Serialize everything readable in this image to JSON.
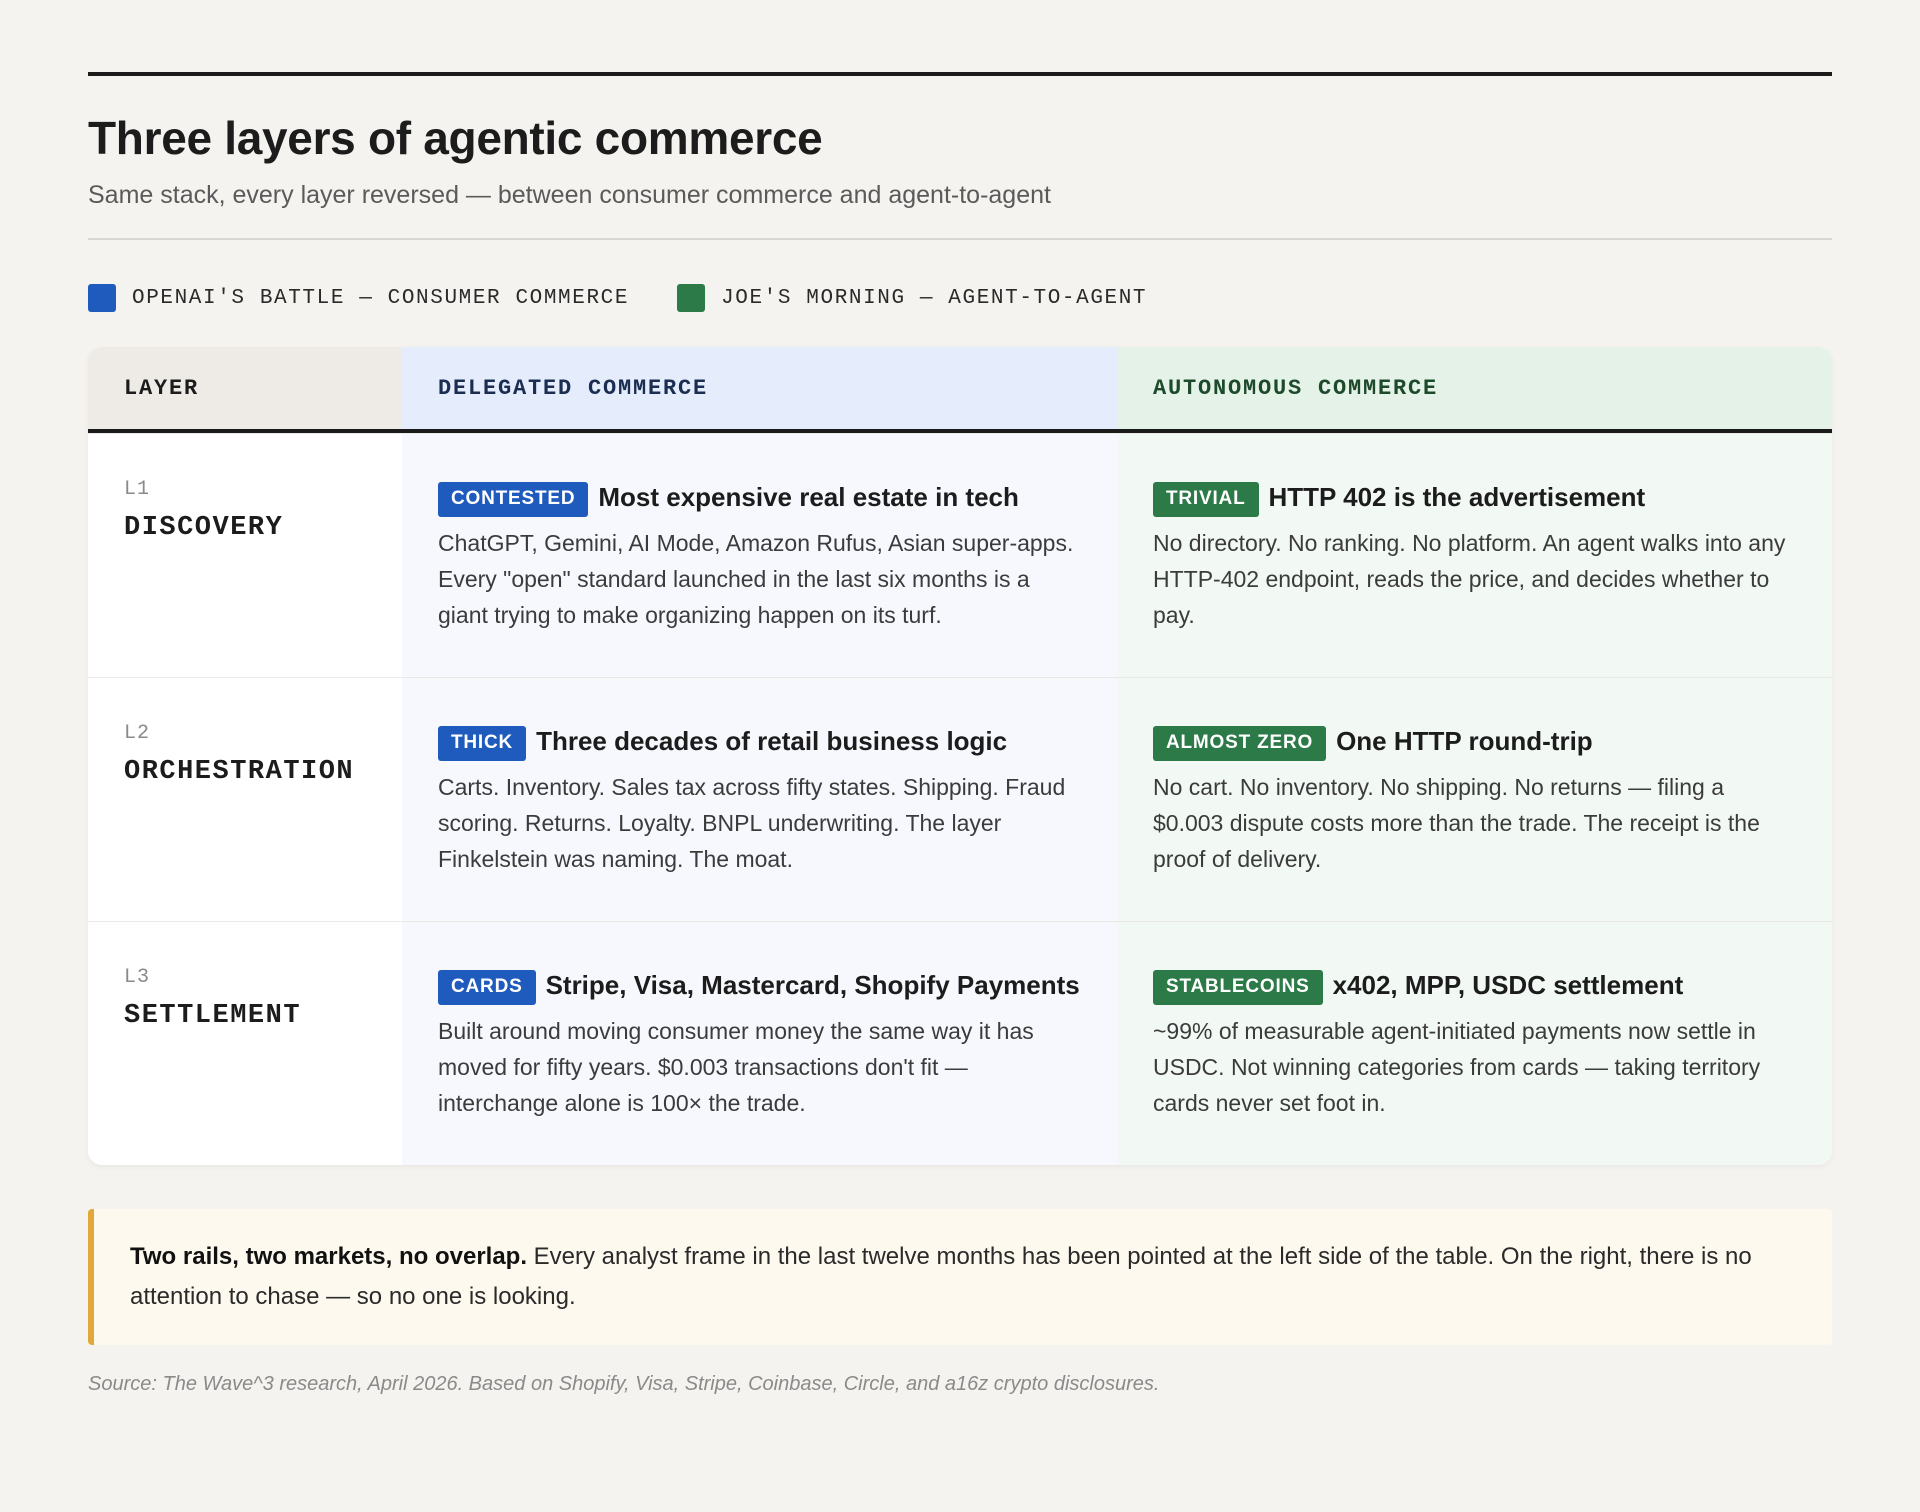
{
  "header": {
    "title": "Three layers of agentic commerce",
    "subtitle": "Same stack, every layer reversed — between consumer commerce and agent-to-agent"
  },
  "legend": [
    {
      "label": "OPENAI'S BATTLE — CONSUMER COMMERCE",
      "color": "#1f5bbd"
    },
    {
      "label": "JOE'S MORNING — AGENT-TO-AGENT",
      "color": "#2b7a47"
    }
  ],
  "table": {
    "columns": [
      "LAYER",
      "DELEGATED COMMERCE",
      "AUTONOMOUS COMMERCE"
    ],
    "rows": [
      {
        "code": "L1",
        "name": "DISCOVERY",
        "delegated": {
          "badge": "CONTESTED",
          "title": "Most expensive real estate in tech",
          "body": "ChatGPT, Gemini, AI Mode, Amazon Rufus, Asian super-apps. Every \"open\" standard launched in the last six months is a giant trying to make organizing happen on its turf."
        },
        "autonomous": {
          "badge": "TRIVIAL",
          "title": "HTTP 402 is the advertisement",
          "body": "No directory. No ranking. No platform. An agent walks into any HTTP-402 endpoint, reads the price, and decides whether to pay."
        }
      },
      {
        "code": "L2",
        "name": "ORCHESTRATION",
        "delegated": {
          "badge": "THICK",
          "title": "Three decades of retail business logic",
          "body": "Carts. Inventory. Sales tax across fifty states. Shipping. Fraud scoring. Returns. Loyalty. BNPL underwriting. The layer Finkelstein was naming. The moat."
        },
        "autonomous": {
          "badge": "ALMOST ZERO",
          "title": "One HTTP round-trip",
          "body": "No cart. No inventory. No shipping. No returns — filing a $0.003 dispute costs more than the trade. The receipt is the proof of delivery."
        }
      },
      {
        "code": "L3",
        "name": "SETTLEMENT",
        "delegated": {
          "badge": "CARDS",
          "title": "Stripe, Visa, Mastercard, Shopify Payments",
          "body": "Built around moving consumer money the same way it has moved for fifty years. $0.003 transactions don't fit — interchange alone is 100× the trade."
        },
        "autonomous": {
          "badge": "STABLECOINS",
          "title": "x402, MPP, USDC settlement",
          "body": "~99% of measurable agent-initiated payments now settle in USDC. Not winning categories from cards — taking territory cards never set foot in."
        }
      }
    ]
  },
  "note": {
    "lead": "Two rails, two markets, no overlap.",
    "text": " Every analyst frame in the last twelve months has been pointed at the left side of the table. On the right, there is no attention to chase — so no one is looking."
  },
  "source": "Source: The Wave^3 research, April 2026. Based on Shopify, Visa, Stripe, Coinbase, Circle, and a16z crypto disclosures.",
  "colors": {
    "delegated_accent": "#1f5bbd",
    "autonomous_accent": "#2b7a47",
    "note_accent": "#e0a93a"
  }
}
